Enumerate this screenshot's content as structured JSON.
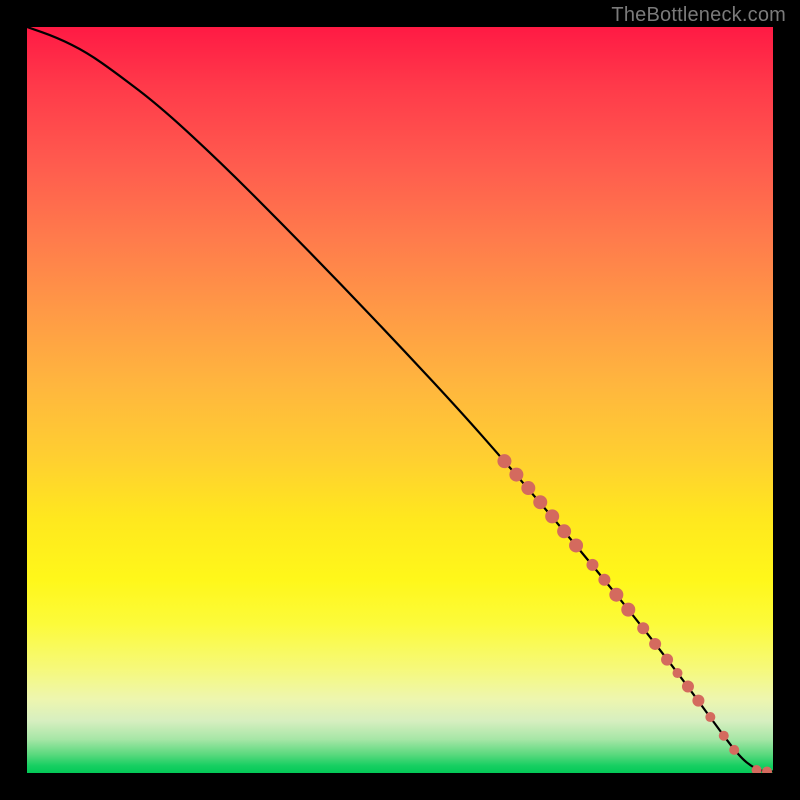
{
  "attribution": "TheBottleneck.com",
  "chart_data": {
    "type": "line",
    "title": "",
    "xlabel": "",
    "ylabel": "",
    "xlim": [
      0,
      100
    ],
    "ylim": [
      0,
      100
    ],
    "grid": false,
    "legend": false,
    "curve": {
      "name": "bottleneck-curve",
      "x": [
        0,
        4,
        8,
        12,
        18,
        26,
        34,
        42,
        50,
        58,
        64,
        70,
        76,
        82,
        88,
        92.5,
        95.5,
        97.5,
        99,
        100
      ],
      "y": [
        100,
        98.6,
        96.6,
        93.8,
        89.2,
        81.8,
        73.8,
        65.6,
        57.2,
        48.6,
        41.8,
        34.8,
        27.6,
        20.2,
        12.4,
        6.2,
        2.2,
        0.6,
        0.2,
        0.2
      ]
    },
    "markers": {
      "name": "highlighted-points",
      "color": "#d46a5e",
      "points": [
        {
          "x": 64.0,
          "y": 41.8,
          "r": 7
        },
        {
          "x": 65.6,
          "y": 40.0,
          "r": 7
        },
        {
          "x": 67.2,
          "y": 38.2,
          "r": 7
        },
        {
          "x": 68.8,
          "y": 36.3,
          "r": 7
        },
        {
          "x": 70.4,
          "y": 34.4,
          "r": 7
        },
        {
          "x": 72.0,
          "y": 32.4,
          "r": 7
        },
        {
          "x": 73.6,
          "y": 30.5,
          "r": 7
        },
        {
          "x": 75.8,
          "y": 27.9,
          "r": 6
        },
        {
          "x": 77.4,
          "y": 25.9,
          "r": 6
        },
        {
          "x": 79.0,
          "y": 23.9,
          "r": 7
        },
        {
          "x": 80.6,
          "y": 21.9,
          "r": 7
        },
        {
          "x": 82.6,
          "y": 19.4,
          "r": 6
        },
        {
          "x": 84.2,
          "y": 17.3,
          "r": 6
        },
        {
          "x": 85.8,
          "y": 15.2,
          "r": 6
        },
        {
          "x": 87.2,
          "y": 13.4,
          "r": 5
        },
        {
          "x": 88.6,
          "y": 11.6,
          "r": 6
        },
        {
          "x": 90.0,
          "y": 9.7,
          "r": 6
        },
        {
          "x": 91.6,
          "y": 7.5,
          "r": 5
        },
        {
          "x": 93.4,
          "y": 5.0,
          "r": 5
        },
        {
          "x": 94.8,
          "y": 3.1,
          "r": 5
        },
        {
          "x": 97.8,
          "y": 0.4,
          "r": 5
        },
        {
          "x": 99.2,
          "y": 0.2,
          "r": 5
        }
      ]
    }
  }
}
